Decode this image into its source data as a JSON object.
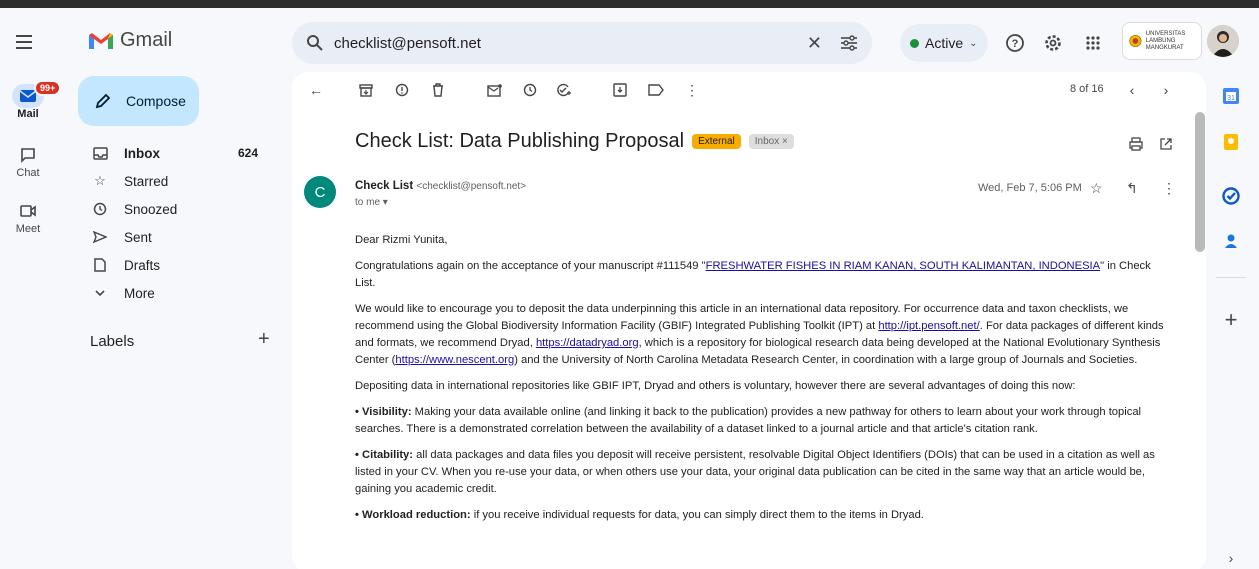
{
  "app": {
    "name": "Gmail"
  },
  "search": {
    "query": "checklist@pensoft.net"
  },
  "status": {
    "label": "Active"
  },
  "university": {
    "name_line1": "UNIVERSITAS",
    "name_line2": "LAMBUNG MANGKURAT"
  },
  "rail": [
    {
      "label": "Mail",
      "badge": "99+"
    },
    {
      "label": "Chat"
    },
    {
      "label": "Meet"
    }
  ],
  "compose_label": "Compose",
  "nav": [
    {
      "label": "Inbox",
      "count": "624",
      "icon": "inbox-icon"
    },
    {
      "label": "Starred",
      "icon": "star-icon"
    },
    {
      "label": "Snoozed",
      "icon": "clock-icon"
    },
    {
      "label": "Sent",
      "icon": "send-icon"
    },
    {
      "label": "Drafts",
      "icon": "draft-icon"
    },
    {
      "label": "More",
      "icon": "chevron-down-icon"
    }
  ],
  "labels_title": "Labels",
  "pager": "8 of 16",
  "email": {
    "subject": "Check List: Data Publishing Proposal",
    "tag_external": "External",
    "tag_inbox": "Inbox ×",
    "avatar_letter": "C",
    "sender_name": "Check List",
    "sender_email": "<checklist@pensoft.net>",
    "to": "to me",
    "date": "Wed, Feb 7, 5:06 PM",
    "greeting": "Dear Rizmi Yunita,",
    "p1_a": "Congratulations again on the acceptance of your manuscript #111549 \"",
    "p1_link": "FRESHWATER FISHES IN RIAM KANAN, SOUTH KALIMANTAN, INDONESIA",
    "p1_b": "\" in Check List.",
    "p2_a": "We would like to encourage you to deposit the data underpinning this article in an international data repository. For occurrence data and taxon checklists, we recommend using the Global Biodiversity Information Facility (GBIF) Integrated Publishing Toolkit (IPT) at ",
    "p2_link1": "http://ipt.pensoft.net/",
    "p2_b": ". For data packages of different kinds and formats, we recommend Dryad, ",
    "p2_link2": "https://datadryad.org",
    "p2_c": ", which is a repository for biological research data being developed at the National Evolutionary Synthesis Center (",
    "p2_link3": "https://www.nescent.org",
    "p2_d": ") and the University of North Carolina Metadata Research Center, in coordination with a large group of Journals and Societies.",
    "p3": "Depositing data in international repositories like GBIF IPT, Dryad and others is voluntary, however there are several advantages of doing this now:",
    "p4_title": "• Visibility:",
    "p4": " Making your data available online (and linking it back to the publication) provides a new pathway for others to learn about your work through topical searches. There is a demonstrated correlation between the availability of a dataset linked to a journal article and that article's citation rank.",
    "p5_title": "• Citability:",
    "p5": " all data packages and data files you deposit will receive persistent, resolvable Digital Object Identifiers (DOIs) that can be used in a citation as well as listed in your CV. When you re-use your data, or when others use your data, your original data publication can be cited in the same way that an article would be, gaining you academic credit.",
    "p6_title": "• Workload reduction:",
    "p6": " if you receive individual requests for data, you can simply direct them to the items in Dryad."
  },
  "colors": {
    "accent": "#c2e7ff",
    "badge": "#d93025",
    "avatar": "#00897b",
    "tag_external": "#f9ab00"
  }
}
